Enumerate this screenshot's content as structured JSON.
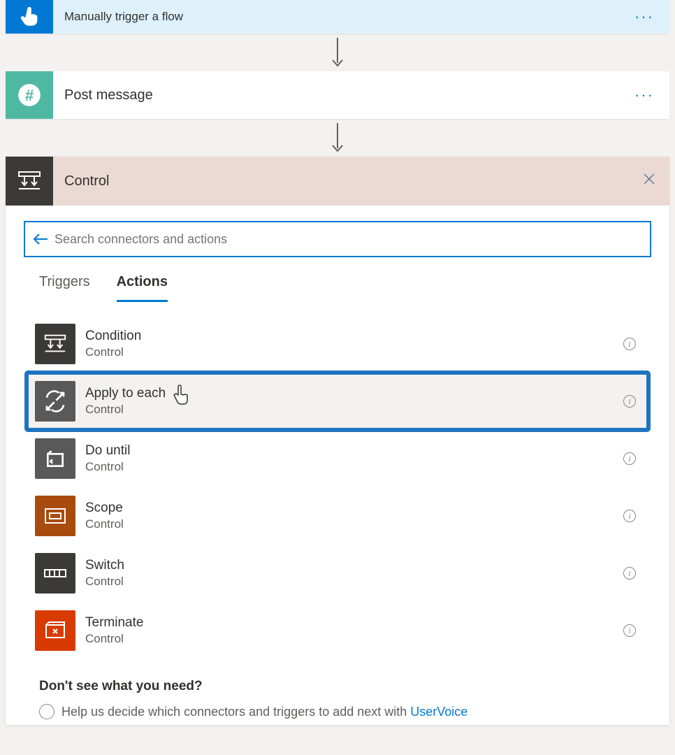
{
  "steps": {
    "trigger": {
      "label": "Manually trigger a flow"
    },
    "post": {
      "label": "Post message"
    }
  },
  "control": {
    "title": "Control",
    "search_placeholder": "Search connectors and actions",
    "tabs": {
      "triggers": "Triggers",
      "actions": "Actions"
    },
    "actions": [
      {
        "name": "Condition",
        "sub": "Control",
        "icon": "condition",
        "tile": "charcoal"
      },
      {
        "name": "Apply to each",
        "sub": "Control",
        "icon": "apply-each",
        "tile": "grey"
      },
      {
        "name": "Do until",
        "sub": "Control",
        "icon": "do-until",
        "tile": "grey"
      },
      {
        "name": "Scope",
        "sub": "Control",
        "icon": "scope",
        "tile": "brown"
      },
      {
        "name": "Switch",
        "sub": "Control",
        "icon": "switch",
        "tile": "charcoal"
      },
      {
        "name": "Terminate",
        "sub": "Control",
        "icon": "terminate",
        "tile": "red"
      }
    ],
    "footer": {
      "q": "Don't see what you need?",
      "line": "Help us decide which connectors and triggers to add next with ",
      "link": "UserVoice"
    }
  }
}
